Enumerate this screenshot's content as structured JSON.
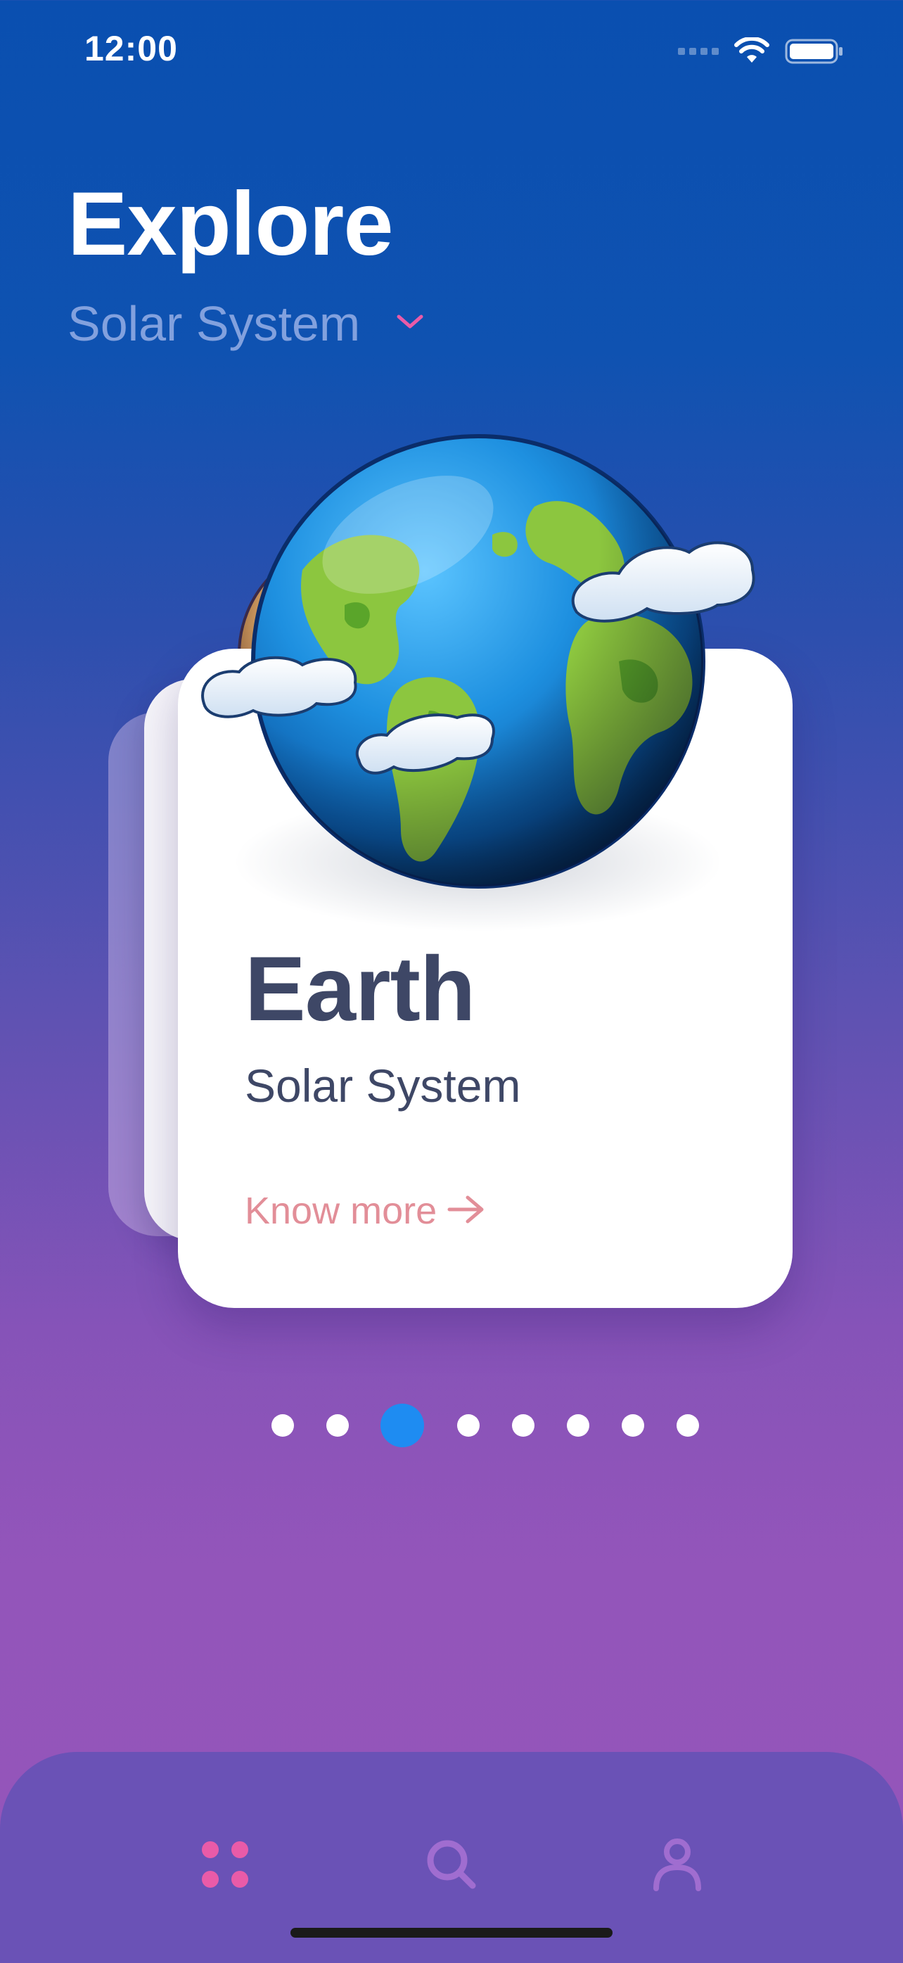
{
  "status_bar": {
    "time": "12:00",
    "icons": [
      "cellular-signal-icon",
      "wifi-icon",
      "battery-icon"
    ]
  },
  "header": {
    "title": "Explore",
    "category": "Solar System",
    "category_icon": "chevron-down-icon"
  },
  "card": {
    "planet_name": "Earth",
    "system": "Solar System",
    "cta_label": "Know more",
    "cta_icon": "arrow-right-icon",
    "illustration": "earth-illustration"
  },
  "pager": {
    "total": 8,
    "active_index": 2
  },
  "tab_bar": {
    "tabs": [
      {
        "name": "home",
        "icon": "grid-dots-icon",
        "active": true
      },
      {
        "name": "search",
        "icon": "search-icon",
        "active": false
      },
      {
        "name": "profile",
        "icon": "profile-icon",
        "active": false
      }
    ]
  },
  "colors": {
    "accent_pink": "#e95ba8",
    "accent_blue": "#1e8cf2",
    "text_dark": "#3e4766",
    "cta_pink": "#e28e98",
    "tab_bar_bg": "#6a52b6"
  }
}
